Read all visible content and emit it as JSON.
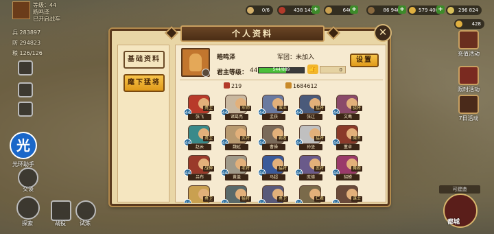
{
  "player": {
    "level_text": "等级：44",
    "name": "皓鸣泽",
    "vip_text": "已开启战车",
    "troops": "283897",
    "defense": "294823",
    "food": "126/126",
    "troops_label": "兵",
    "defense_label": "防",
    "food_label": "粮"
  },
  "resources": [
    {
      "label": "0/6",
      "color": "#d4b06a"
    },
    {
      "label": "438 142",
      "color": "#b33a2a"
    },
    {
      "label": "646",
      "color": "#c9a050"
    },
    {
      "label": "86 940",
      "color": "#8a6a40"
    },
    {
      "label": "579 400",
      "color": "#e0b040"
    },
    {
      "label": "296 824",
      "color": "#d8c05a"
    }
  ],
  "gold_sub": "428",
  "side_buttons": [
    {
      "label": "充值活动",
      "color": "#6a2e1e"
    },
    {
      "label": "限时活动",
      "color": "#7a2a20"
    },
    {
      "label": "7日活动",
      "color": "#4a2a1a"
    }
  ],
  "left_buttons": {
    "chat": "交谈",
    "explore": "探索",
    "battle": "战役",
    "trial": "试炼"
  },
  "watermark": {
    "glyph": "光",
    "text": "光环助手"
  },
  "dialog": {
    "title": "个人资料",
    "close": "✕",
    "tabs": [
      {
        "label": "基础资料",
        "active": false
      },
      {
        "label": "麾下猛将",
        "active": true
      }
    ],
    "profile": {
      "name": "皓鸣泽",
      "guild": "军团：未加入",
      "lord_level_label": "君主等级：",
      "lord_level": "44",
      "xp_text": "544/889",
      "xp_fraction": 0.61,
      "likes": "0",
      "settings_button": "设置"
    },
    "stats": {
      "hero_count": "219",
      "power": "1684612"
    },
    "heroes": [
      {
        "name": "张飞",
        "role": "勇卫",
        "level": "44",
        "color": "#b83a2a"
      },
      {
        "name": "诸葛亮",
        "role": "军师",
        "level": "44",
        "color": "#c9b8a0"
      },
      {
        "name": "孟获",
        "role": "蛮王",
        "level": "44",
        "color": "#6a7aa0"
      },
      {
        "name": "张辽",
        "role": "猛将",
        "level": "44",
        "color": "#4a5a7a"
      },
      {
        "name": "文鸯",
        "role": "骁将",
        "level": "44",
        "color": "#8a4a6a"
      },
      {
        "name": "赵云",
        "role": "勇卫",
        "level": "44",
        "color": "#3a8a8a"
      },
      {
        "name": "魏延",
        "role": "武将",
        "level": "44",
        "color": "#b89a70"
      },
      {
        "name": "曹操",
        "role": "霸者",
        "level": "44",
        "color": "#7a6a5a"
      },
      {
        "name": "孙坚",
        "role": "猛将",
        "level": "44",
        "color": "#c0c0c0"
      },
      {
        "name": "董卓",
        "role": "魔王",
        "level": "44",
        "color": "#8a3a2a"
      },
      {
        "name": "吕布",
        "role": "战神",
        "level": "44",
        "color": "#9a3a2a"
      },
      {
        "name": "黄盖",
        "role": "老将",
        "level": "44",
        "color": "#a09a8a"
      },
      {
        "name": "马超",
        "role": "猛将",
        "level": "44",
        "color": "#3a5a9a"
      },
      {
        "name": "庞德",
        "role": "武将",
        "level": "44",
        "color": "#6a5a8a"
      },
      {
        "name": "貂蝉",
        "role": "舞姬",
        "level": "44",
        "color": "#9a3a6a"
      },
      {
        "name": "周泰",
        "role": "勇卫",
        "level": "44",
        "color": "#c9a050"
      },
      {
        "name": "许褚",
        "role": "猛将",
        "level": "44",
        "color": "#5a6a6a"
      },
      {
        "name": "典韦",
        "role": "勇卫",
        "level": "44",
        "color": "#5a5a7a"
      },
      {
        "name": "刘备",
        "role": "仁君",
        "level": "44",
        "color": "#7a6a4a"
      },
      {
        "name": "许攸",
        "role": "谋士",
        "level": "44",
        "color": "#6a4a3a"
      }
    ]
  },
  "bottom_right": {
    "label": "都城",
    "hint": "可建造"
  }
}
